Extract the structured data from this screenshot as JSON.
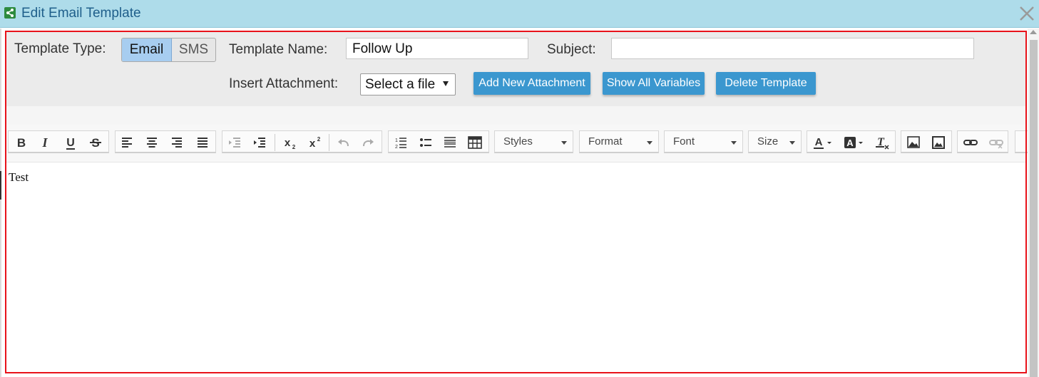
{
  "window": {
    "title": "Edit Email Template",
    "share_icon": "share-icon",
    "close_icon": "close-icon"
  },
  "form": {
    "template_type_label": "Template Type:",
    "template_type_options": [
      "Email",
      "SMS"
    ],
    "template_type_selected": "Email",
    "template_name_label": "Template Name:",
    "template_name_value": "Follow Up",
    "subject_label": "Subject:",
    "subject_value": "",
    "insert_attachment_label": "Insert Attachment:",
    "attachment_select_value": "Select a file",
    "buttons": {
      "add_attachment": "Add New Attachment",
      "show_variables": "Show All Variables",
      "delete_template": "Delete Template"
    }
  },
  "toolbar": {
    "styles_label": "Styles",
    "format_label": "Format",
    "font_label": "Font",
    "size_label": "Size",
    "icons": [
      "bold-icon",
      "italic-icon",
      "underline-icon",
      "strikethrough-icon",
      "align-left-icon",
      "align-center-icon",
      "align-right-icon",
      "align-justify-icon",
      "outdent-icon",
      "indent-icon",
      "subscript-icon",
      "superscript-icon",
      "undo-icon",
      "redo-icon",
      "numbered-list-icon",
      "bulleted-list-icon",
      "horizontal-rule-icon",
      "table-icon",
      "text-color-icon",
      "background-color-icon",
      "remove-format-icon",
      "image-icon",
      "image-gallery-icon",
      "link-icon",
      "unlink-icon"
    ]
  },
  "editor": {
    "content": "Test"
  },
  "colors": {
    "accent_button": "#3b97cf",
    "title_bar": "#aedcea",
    "highlight_border": "#e8121a",
    "selected_segment": "#a7cdf0"
  }
}
